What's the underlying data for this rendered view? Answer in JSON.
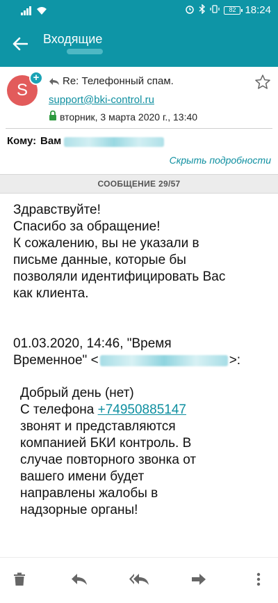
{
  "status_bar": {
    "battery": "82",
    "time": "18:24"
  },
  "appbar": {
    "title": "Входящие"
  },
  "message": {
    "avatar_letter": "S",
    "subject": "Re: Телефонный спам.",
    "sender": "support@bki-control.ru",
    "date": "вторник, 3 марта 2020 г., 13:40",
    "to_label": "Кому:",
    "to_name": "Вам",
    "hide_details": "Скрыть подробности",
    "counter": "СООБЩЕНИЕ 29/57"
  },
  "body": {
    "lines": [
      "Здравствуйте!",
      "Спасибо за обращение!",
      "К сожалению, вы не указали в",
      "письме данные, которые бы",
      "позволяли идентифицировать Вас",
      "как клиента."
    ],
    "quote_head_1": "01.03.2020, 14:46, \"Время",
    "quote_head_2a": "Временное\" <",
    "quote_head_2b": ">:",
    "quote_1": "Добрый день (нет)",
    "quote_2a": "С телефона ",
    "phone": "+74950885147",
    "quote_3": "звонят и представляются",
    "quote_4": "компанией БКИ контроль. В",
    "quote_5": "случае повторного звонка от",
    "quote_6": "вашего имени будет",
    "quote_7": "направлены жалобы в",
    "quote_8": "надзорные органы!"
  },
  "icons": {
    "back": "arrow-left-icon",
    "star": "star-icon",
    "delete": "trash-icon",
    "reply": "reply-icon",
    "reply_all": "reply-all-icon",
    "forward": "forward-icon",
    "more": "more-vertical-icon"
  },
  "colors": {
    "accent": "#0e95a6",
    "avatar": "#e25b5b",
    "link": "#0e8fa0"
  }
}
